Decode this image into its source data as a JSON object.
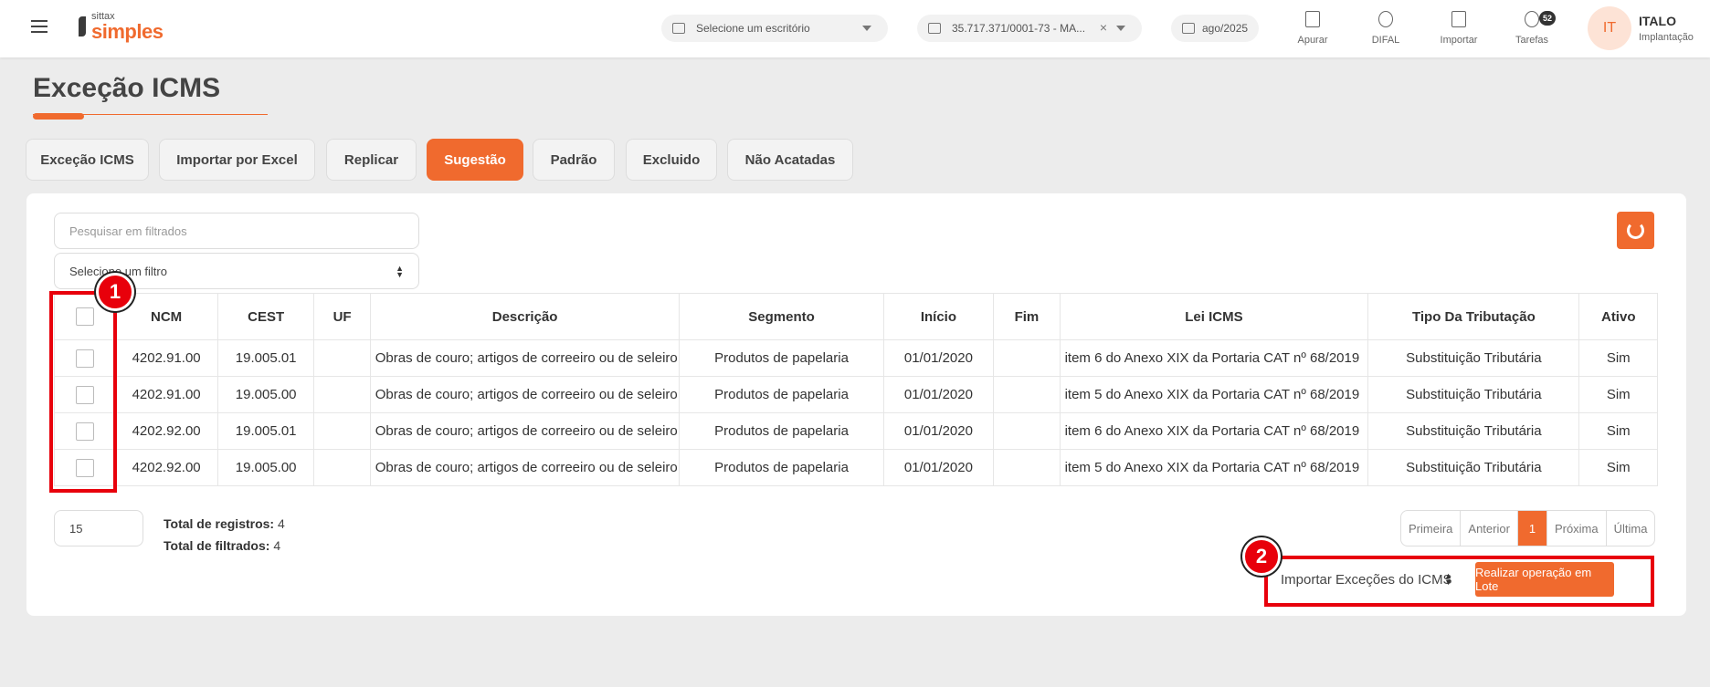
{
  "topbar": {
    "logo_small": "sittax",
    "logo_big": "simples",
    "office_placeholder": "Selecione um escritório",
    "company": "35.717.371/0001-73 - MA...",
    "clear_symbol": "×",
    "period": "ago/2025",
    "actions": [
      "Apurar",
      "DIFAL",
      "Importar",
      "Tarefas"
    ],
    "tasks_badge": "52",
    "avatar_initials": "IT",
    "user_name": "ITALO",
    "user_role": "Implantação"
  },
  "page": {
    "title": "Exceção ICMS"
  },
  "tabs": [
    "Exceção ICMS",
    "Importar por Excel",
    "Replicar",
    "Sugestão",
    "Padrão",
    "Excluido",
    "Não Acatadas"
  ],
  "filters": {
    "search_placeholder": "Pesquisar em filtrados",
    "filter_select": "Selecione um filtro"
  },
  "table": {
    "columns": [
      "NCM",
      "CEST",
      "UF",
      "Descrição",
      "Segmento",
      "Início",
      "Fim",
      "Lei ICMS",
      "Tipo Da Tributação",
      "Ativo"
    ],
    "rows": [
      [
        "4202.91.00",
        "19.005.01",
        "",
        "Obras de couro; artigos de correeiro ou de seleiro",
        "Produtos de papelaria",
        "01/01/2020",
        "",
        "item 6 do Anexo XIX da Portaria CAT nº 68/2019",
        "Substituição Tributária",
        "Sim"
      ],
      [
        "4202.91.00",
        "19.005.00",
        "",
        "Obras de couro; artigos de correeiro ou de seleiro",
        "Produtos de papelaria",
        "01/01/2020",
        "",
        "item 5 do Anexo XIX da Portaria CAT nº 68/2019",
        "Substituição Tributária",
        "Sim"
      ],
      [
        "4202.92.00",
        "19.005.01",
        "",
        "Obras de couro; artigos de correeiro ou de seleiro",
        "Produtos de papelaria",
        "01/01/2020",
        "",
        "item 6 do Anexo XIX da Portaria CAT nº 68/2019",
        "Substituição Tributária",
        "Sim"
      ],
      [
        "4202.92.00",
        "19.005.00",
        "",
        "Obras de couro; artigos de correeiro ou de seleiro",
        "Produtos de papelaria",
        "01/01/2020",
        "",
        "item 5 do Anexo XIX da Portaria CAT nº 68/2019",
        "Substituição Tributária",
        "Sim"
      ]
    ]
  },
  "footer": {
    "page_size": "15",
    "total_label": "Total de registros:",
    "total_value": "4",
    "filtered_label": "Total de filtrados:",
    "filtered_value": "4",
    "pager": [
      "Primeira",
      "Anterior",
      "1",
      "Próxima",
      "Última"
    ],
    "bulk_select": "Importar Exceções do ICMS",
    "bulk_button": "Realizar operação em Lote"
  },
  "annotations": [
    "1",
    "2"
  ],
  "colors": {
    "accent": "#f06a2e",
    "highlight": "#e8000b"
  }
}
